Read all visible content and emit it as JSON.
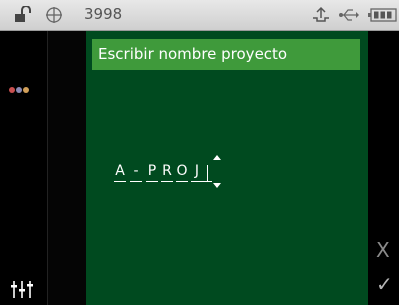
{
  "statusbar": {
    "counter": "3998",
    "lock_icon": "lock-open-icon",
    "target_icon": "crosshair-icon",
    "upload_icon": "upload-icon",
    "usb_icon": "usb-icon",
    "battery_icon": "battery-icon"
  },
  "sidebar": {
    "dots_icon": "colored-dots-icon",
    "dot_colors": [
      "#c85050",
      "#8a8ab4",
      "#d2a05a"
    ],
    "settings_icon": "sliders-icon"
  },
  "main": {
    "title": "Escribir nombre proyecto",
    "name_chars": [
      "A",
      "-",
      "P",
      "R",
      "O",
      "J"
    ]
  },
  "actions": {
    "cancel_label": "X",
    "confirm_label": "✓"
  },
  "colors": {
    "panel": "#004a1f",
    "header": "#3f9a3b"
  }
}
